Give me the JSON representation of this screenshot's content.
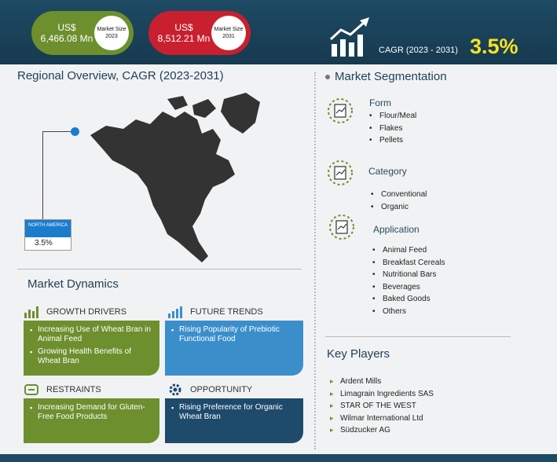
{
  "header": {
    "size_2023_value": "US$ 6,466.08 Mn",
    "size_2023_label": "Market Size 2023",
    "size_2031_value": "US$ 8,512.21 Mn",
    "size_2031_label": "Market Size 2031",
    "cagr_label": "CAGR (2023 - 2031)",
    "cagr_value": "3.5%"
  },
  "regional": {
    "title": "Regional Overview, CAGR (2023-2031)",
    "region_name": "NORTH AMERICA",
    "region_cagr": "3.5%"
  },
  "dynamics": {
    "title": "Market Dynamics",
    "growth_drivers": {
      "title": "GROWTH DRIVERS",
      "items": [
        "Increasing Use of Wheat Bran in Animal Feed",
        "Growing Health Benefits of Wheat Bran"
      ]
    },
    "future_trends": {
      "title": "FUTURE TRENDS",
      "items": [
        "Rising Popularity of Prebiotic Functional Food"
      ]
    },
    "restraints": {
      "title": "RESTRAINTS",
      "items": [
        "Increasing Demand for Gluten-Free Food Products"
      ]
    },
    "opportunity": {
      "title": "OPPORTUNITY",
      "items": [
        "Rising Preference for Organic Wheat Bran"
      ]
    }
  },
  "segmentation": {
    "title": "Market Segmentation",
    "form": {
      "title": "Form",
      "items": [
        "Flour/Meal",
        "Flakes",
        "Pellets"
      ]
    },
    "category": {
      "title": "Category",
      "items": [
        "Conventional",
        "Organic"
      ]
    },
    "application": {
      "title": "Application",
      "items": [
        "Animal Feed",
        "Breakfast Cereals",
        "Nutritional Bars",
        "Beverages",
        "Baked Goods",
        "Others"
      ]
    }
  },
  "key_players": {
    "title": "Key Players",
    "items": [
      "Ardent Mills",
      "Limagrain Ingredients SAS",
      "STAR OF THE WEST",
      "Wilmar International Ltd",
      "Südzucker AG"
    ]
  },
  "colors": {
    "navy": "#1e4a63",
    "green": "#6d8f2e",
    "red": "#c8202e",
    "blue": "#3a8fcb",
    "accent_yellow": "#f7e321"
  }
}
